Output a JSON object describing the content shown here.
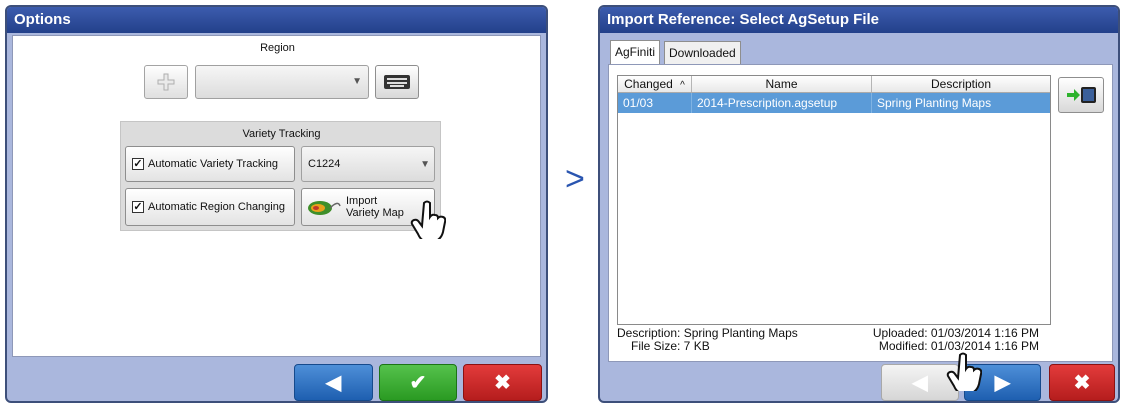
{
  "left_window": {
    "title": "Options",
    "region_label": "Region",
    "region_value": "",
    "variety_tracking": {
      "heading": "Variety Tracking",
      "auto_variety_label": "Automatic Variety Tracking",
      "variety_value": "C1224",
      "auto_region_label": "Automatic Region Changing",
      "import_label_line1": "Import",
      "import_label_line2": "Variety Map"
    },
    "nav": {
      "back_icon": "◀",
      "accept_icon": "✔",
      "cancel_icon": "✖"
    }
  },
  "separator": ">",
  "right_window": {
    "title": "Import Reference: Select AgSetup File",
    "tabs": [
      "AgFiniti",
      "Downloaded"
    ],
    "columns": [
      "Changed",
      "Name",
      "Description"
    ],
    "sort_indicator": "^",
    "rows": [
      {
        "changed": "01/03",
        "name": "2014-Prescription.agsetup",
        "description": "Spring Planting Maps"
      }
    ],
    "description_line": "Description: Spring Planting Maps",
    "file_size_line": "File Size: 7 KB",
    "uploaded_line": "Uploaded: 01/03/2014 1:16 PM",
    "modified_line": "Modified: 01/03/2014 1:16 PM",
    "nav": {
      "back_icon": "◀",
      "next_icon": "▶",
      "cancel_icon": "✖"
    }
  }
}
